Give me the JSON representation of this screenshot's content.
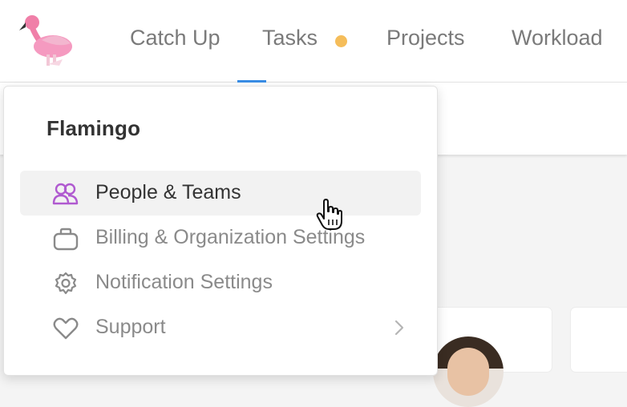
{
  "nav": {
    "items": [
      {
        "label": "Catch Up"
      },
      {
        "label": "Tasks",
        "has_notification": true,
        "active": true
      },
      {
        "label": "Projects"
      },
      {
        "label": "Workload"
      }
    ],
    "notification_color": "#f5bd5a",
    "active_underline_color": "#3a8ee6"
  },
  "logo": {
    "icon": "flamingo-logo-icon"
  },
  "dropdown": {
    "title": "Flamingo",
    "items": [
      {
        "label": "People & Teams",
        "icon": "people-icon",
        "hovered": true
      },
      {
        "label": "Billing & Organization Settings",
        "icon": "briefcase-icon"
      },
      {
        "label": "Notification Settings",
        "icon": "gear-icon"
      },
      {
        "label": "Support",
        "icon": "heart-icon",
        "has_submenu": true
      }
    ]
  },
  "colors": {
    "accent_people_icon": "#b05ad0",
    "muted_text": "#8a8a8a"
  }
}
